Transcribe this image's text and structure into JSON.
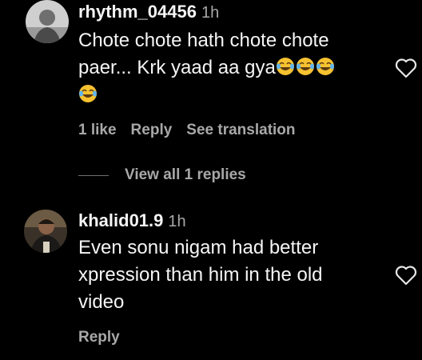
{
  "comments": [
    {
      "username": "rhythm_04456",
      "time": "1h",
      "text_lines": [
        "Chote chote hath chote chote",
        "paer... Krk yaad aa gya"
      ],
      "emoji_count_line2": 3,
      "emoji_count_line3": 1,
      "likes": "1 like",
      "reply_label": "Reply",
      "translate_label": "See translation",
      "view_replies": "View all 1 replies"
    },
    {
      "username": "khalid01.9",
      "time": "1h",
      "text_lines": [
        "Even sonu nigam had better",
        "xpression than him in the old",
        "video"
      ],
      "reply_label": "Reply"
    }
  ],
  "icons": {
    "emoji": "face-with-tears-of-joy-icon",
    "like": "heart-outline-icon"
  },
  "colors": {
    "background": "#000000",
    "primary_text": "#f5f5f5",
    "secondary_text": "#a8a8a8",
    "emoji_face": "#f7c230"
  }
}
